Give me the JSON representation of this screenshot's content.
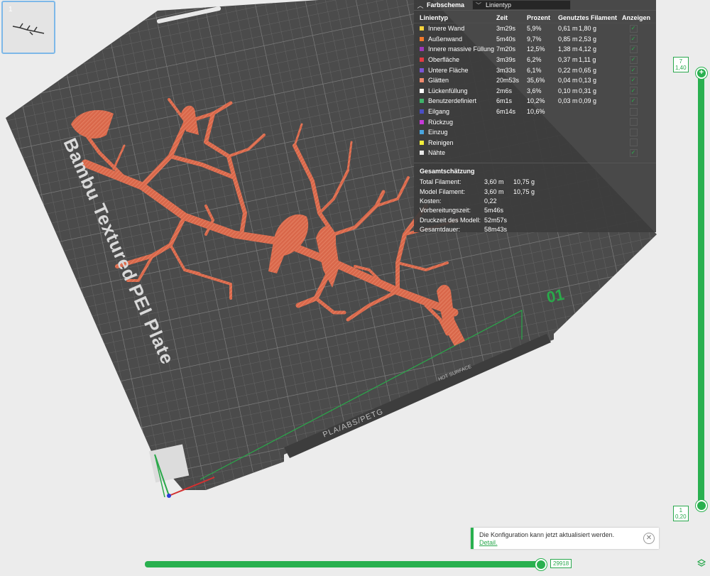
{
  "plate": {
    "number": "1",
    "plate_text": "Bambu Textured PEI Plate",
    "plate_index": "01",
    "filament_label": "PLA/ABS/PETG",
    "hot_label": "HOT SURFACE"
  },
  "legend": {
    "title": "Farbschema",
    "scheme": "Linientyp",
    "columns": [
      "Linientyp",
      "Zeit",
      "Prozent",
      "Genutztes Filament",
      "Anzeigen"
    ],
    "rows": [
      {
        "name": "Innere Wand",
        "color": "#f5d33b",
        "time": "3m29s",
        "pct": "5,9%",
        "len": "0,61 m",
        "weight": "1,80 g",
        "shown": true
      },
      {
        "name": "Außenwand",
        "color": "#f2792b",
        "time": "5m40s",
        "pct": "9,7%",
        "len": "0,85 m",
        "weight": "2,53 g",
        "shown": true
      },
      {
        "name": "Innere massive Füllung",
        "color": "#9b38b7",
        "time": "7m20s",
        "pct": "12,5%",
        "len": "1,38 m",
        "weight": "4,12 g",
        "shown": true
      },
      {
        "name": "Oberfläche",
        "color": "#e23b43",
        "time": "3m39s",
        "pct": "6,2%",
        "len": "0,37 m",
        "weight": "1,11 g",
        "shown": true
      },
      {
        "name": "Untere Fläche",
        "color": "#7a55d6",
        "time": "3m33s",
        "pct": "6,1%",
        "len": "0,22 m",
        "weight": "0,65 g",
        "shown": true
      },
      {
        "name": "Glätten",
        "color": "#f08a6e",
        "time": "20m53s",
        "pct": "35,6%",
        "len": "0,04 m",
        "weight": "0,13 g",
        "shown": true
      },
      {
        "name": "Lückenfüllung",
        "color": "#ffffff",
        "time": "2m6s",
        "pct": "3,6%",
        "len": "0,10 m",
        "weight": "0,31 g",
        "shown": true
      },
      {
        "name": "Benutzerdefiniert",
        "color": "#3fb36a",
        "time": "6m1s",
        "pct": "10,2%",
        "len": "0,03 m",
        "weight": "0,09 g",
        "shown": true
      },
      {
        "name": "Eilgang",
        "color": "#4a4ec4",
        "time": "6m14s",
        "pct": "10,6%",
        "len": "",
        "weight": "",
        "shown": false
      },
      {
        "name": "Rückzug",
        "color": "#c63ad9",
        "time": "",
        "pct": "",
        "len": "",
        "weight": "",
        "shown": false
      },
      {
        "name": "Einzug",
        "color": "#4aa6e0",
        "time": "",
        "pct": "",
        "len": "",
        "weight": "",
        "shown": false
      },
      {
        "name": "Reinigen",
        "color": "#f2ee3c",
        "time": "",
        "pct": "",
        "len": "",
        "weight": "",
        "shown": false
      },
      {
        "name": "Nähte",
        "color": "#e8e8e8",
        "time": "",
        "pct": "",
        "len": "",
        "weight": "",
        "shown": true
      }
    ],
    "summary_title": "Gesamtschätzung",
    "summary": [
      {
        "label": "Total Filament:",
        "v1": "3,60 m",
        "v2": "10,75 g"
      },
      {
        "label": "Model Filament:",
        "v1": "3,60 m",
        "v2": "10,75 g"
      },
      {
        "label": "Kosten:",
        "v1": "0,22",
        "v2": ""
      },
      {
        "label": "Vorbereitungszeit:",
        "v1": "5m46s",
        "v2": ""
      },
      {
        "label": "Druckzeit des Modell:",
        "v1": "52m57s",
        "v2": ""
      },
      {
        "label": "Gesamtdauer:",
        "v1": "58m43s",
        "v2": ""
      }
    ]
  },
  "vslider": {
    "top_layer": "7",
    "top_height": "1,40",
    "bottom_layer": "1",
    "bottom_height": "0,20"
  },
  "hslider": {
    "value": "29918"
  },
  "notification": {
    "text": "Die Konfiguration kann jetzt aktualisiert werden.",
    "link": "Detail."
  }
}
